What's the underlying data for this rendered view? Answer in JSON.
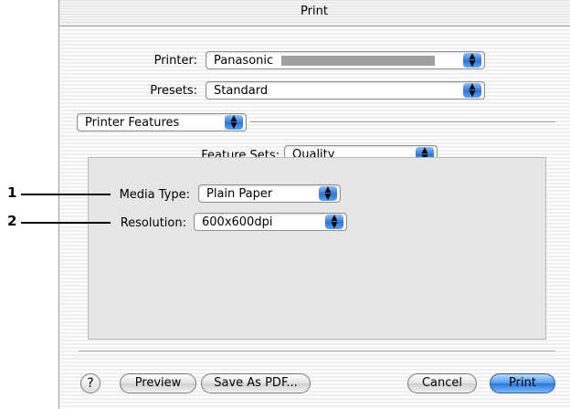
{
  "window": {
    "title": "Print"
  },
  "printer": {
    "label": "Printer:",
    "value": "Panasonic"
  },
  "presets": {
    "label": "Presets:",
    "value": "Standard"
  },
  "pane": {
    "value": "Printer Features"
  },
  "feature_sets": {
    "label": "Feature Sets:",
    "value": "Quality"
  },
  "media_type": {
    "label": "Media Type:",
    "value": "Plain Paper"
  },
  "resolution": {
    "label": "Resolution:",
    "value": "600x600dpi"
  },
  "callouts": [
    "1",
    "2"
  ],
  "footer": {
    "help_label": "?",
    "preview_label": "Preview",
    "save_pdf_label": "Save As PDF...",
    "cancel_label": "Cancel",
    "print_label": "Print"
  },
  "colors": {
    "accent": "#2a76dc"
  },
  "icons": {
    "popup_arrows": "updown-arrows-icon",
    "help": "help-icon"
  }
}
